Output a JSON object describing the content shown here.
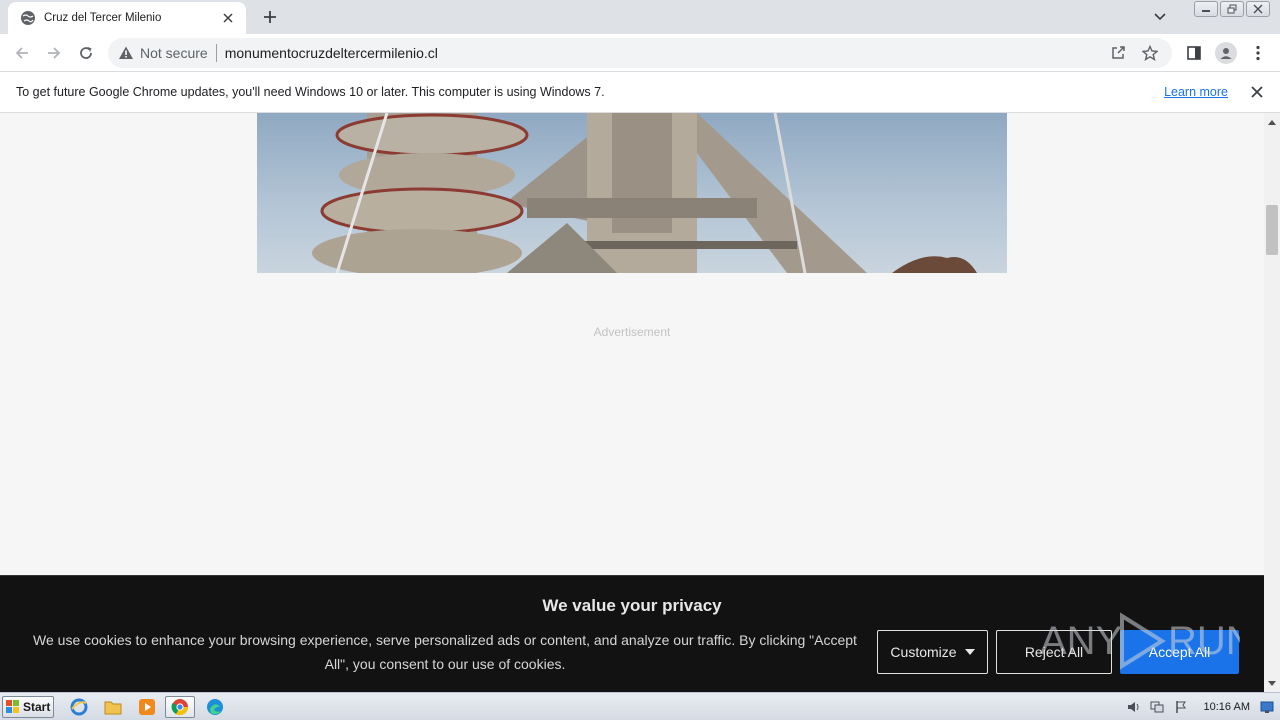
{
  "browser": {
    "tab": {
      "title": "Cruz del Tercer Milenio"
    },
    "address": {
      "security_label": "Not secure",
      "url": "monumentocruzdeltercermilenio.cl"
    }
  },
  "infobar": {
    "message": "To get future Google Chrome updates, you'll need Windows 10 or later. This computer is using Windows 7.",
    "link": "Learn more"
  },
  "page": {
    "ad_label": "Advertisement"
  },
  "cookie_banner": {
    "title": "We value your privacy",
    "text": "We use cookies to enhance your browsing experience, serve personalized ads or content, and analyze our traffic. By clicking \"Accept All\", you consent to our use of cookies.",
    "customize_label": "Customize",
    "reject_label": "Reject All",
    "accept_label": "Accept All"
  },
  "watermark": {
    "text": "ANY RUN"
  },
  "taskbar": {
    "start_label": "Start",
    "clock": "10:16 AM",
    "apps": [
      "internet-explorer-icon",
      "folder-icon",
      "media-player-icon",
      "chrome-icon",
      "edge-icon"
    ]
  },
  "colors": {
    "accent": "#1a73e8",
    "banner_bg": "#121212",
    "page_bg": "#f6f6f6"
  }
}
